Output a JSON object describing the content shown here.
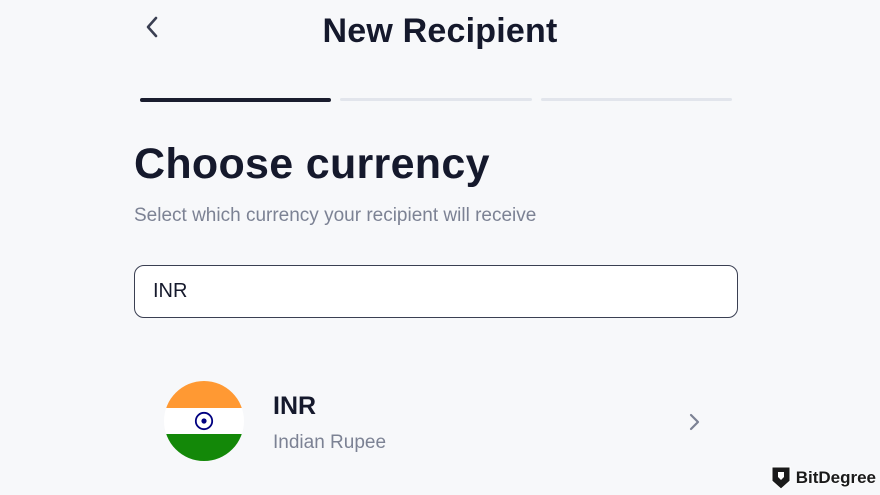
{
  "header": {
    "title": "New Recipient",
    "back_icon": "chevron-left-icon"
  },
  "progress": {
    "total_steps": 3,
    "current_step": 1
  },
  "main": {
    "heading": "Choose currency",
    "subheading": "Select which currency your recipient will receive"
  },
  "search": {
    "value": "INR",
    "placeholder": ""
  },
  "results": [
    {
      "code": "INR",
      "name": "Indian Rupee",
      "flag": "india-flag-icon",
      "chevron": "chevron-right-icon"
    }
  ],
  "watermark": {
    "text": "BitDegree",
    "icon": "bitdegree-logo-icon"
  },
  "colors": {
    "background": "#f7f8fa",
    "text_primary": "#15192c",
    "text_secondary": "#7c8294",
    "progress_active": "#1a1d2e",
    "progress_inactive": "#e2e5ec"
  }
}
